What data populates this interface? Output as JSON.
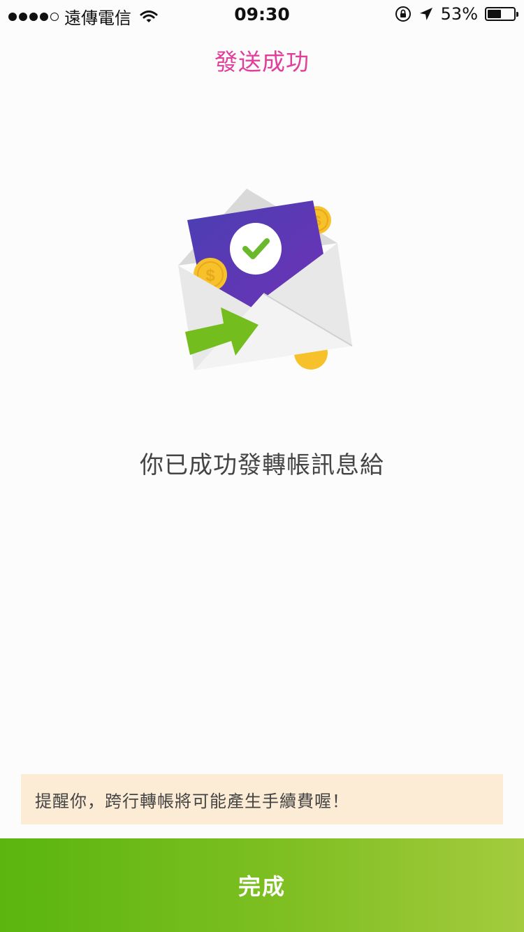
{
  "status_bar": {
    "carrier": "遠傳電信",
    "time": "09:30",
    "battery_percent": "53%",
    "battery_level": 0.53,
    "signal_bars_filled": 4,
    "signal_bars_total": 5
  },
  "header": {
    "title": "發送成功"
  },
  "illustration": {
    "icons": [
      "envelope-icon",
      "check-icon",
      "coin-icon",
      "send-arrow-icon"
    ],
    "colors": {
      "card": "#5b38b8",
      "check": "#6ab92c",
      "coin": "#f6c12a",
      "arrow": "#74bd1f"
    }
  },
  "main": {
    "message": "你已成功發轉帳訊息給"
  },
  "notice": {
    "text": "提醒你，跨行轉帳將可能產生手續費喔！"
  },
  "footer": {
    "done_label": "完成"
  },
  "colors": {
    "title": "#e33d9b",
    "notice_bg": "#fdecd5",
    "button_gradient_start": "#5ab50e",
    "button_gradient_end": "#a4cb3e"
  }
}
